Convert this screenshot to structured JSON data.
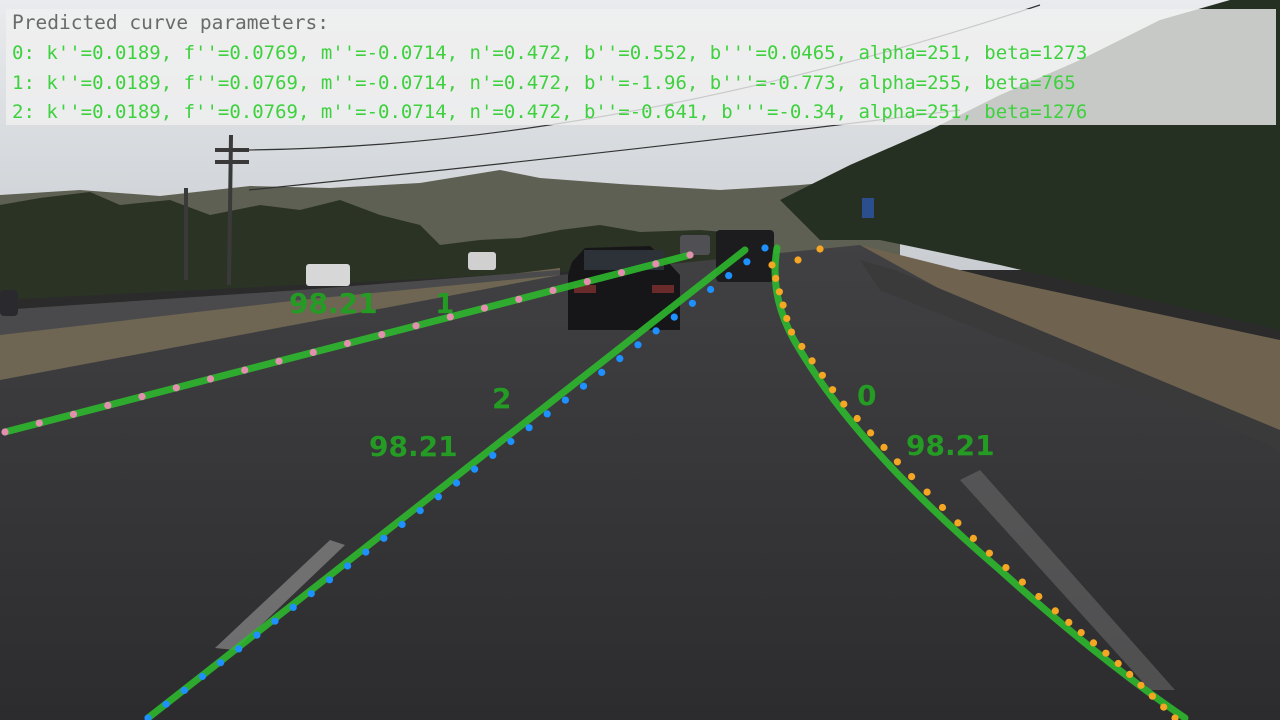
{
  "overlay": {
    "title": "Predicted curve parameters:",
    "lines": [
      "0: k''=0.0189, f''=0.0769, m''=-0.0714, n'=0.472, b''=0.552, b'''=0.0465, alpha=251, beta=1273",
      "1: k''=0.0189, f''=0.0769, m''=-0.0714, n'=0.472, b''=-1.96, b'''=-0.773, alpha=255, beta=765",
      "2: k''=0.0189, f''=0.0769, m''=-0.0714, n'=0.472, b''=-0.641, b'''=-0.34, alpha=251, beta=1276"
    ],
    "text_color": "#3ed13e",
    "title_color": "#6a6a6a"
  },
  "lanes": [
    {
      "id": "0",
      "score": "98.21",
      "dot_color": "#f5a623"
    },
    {
      "id": "1",
      "score": "98.21",
      "dot_color": "#e58fb0"
    },
    {
      "id": "2",
      "score": "98.21",
      "dot_color": "#1e90ff"
    }
  ],
  "colors": {
    "prediction_line": "#2db82d",
    "label": "#249c24"
  }
}
